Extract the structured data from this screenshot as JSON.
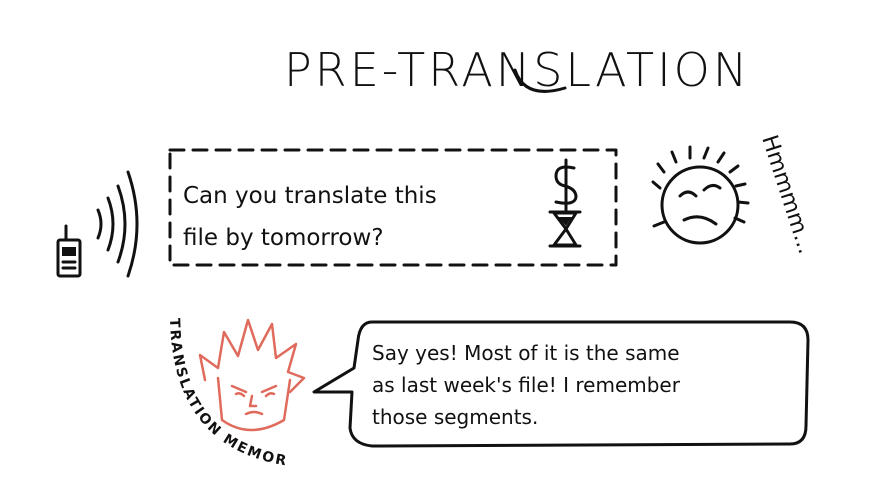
{
  "title": "PRE-TRANSLATION",
  "request": {
    "line1": "Can you translate this",
    "line2": "file by tomorrow?"
  },
  "request_icons": [
    "dollar-icon",
    "hourglass-icon"
  ],
  "thinker": {
    "thought": "Hmmmm..."
  },
  "memory": {
    "label": "TRANSLATION MEMORY",
    "reply_line1": "Say yes! Most of it is the same",
    "reply_line2": "as last week's file! I remember",
    "reply_line3": "those segments."
  },
  "colors": {
    "ink": "#111111",
    "memory_accent": "#e06b5c"
  }
}
